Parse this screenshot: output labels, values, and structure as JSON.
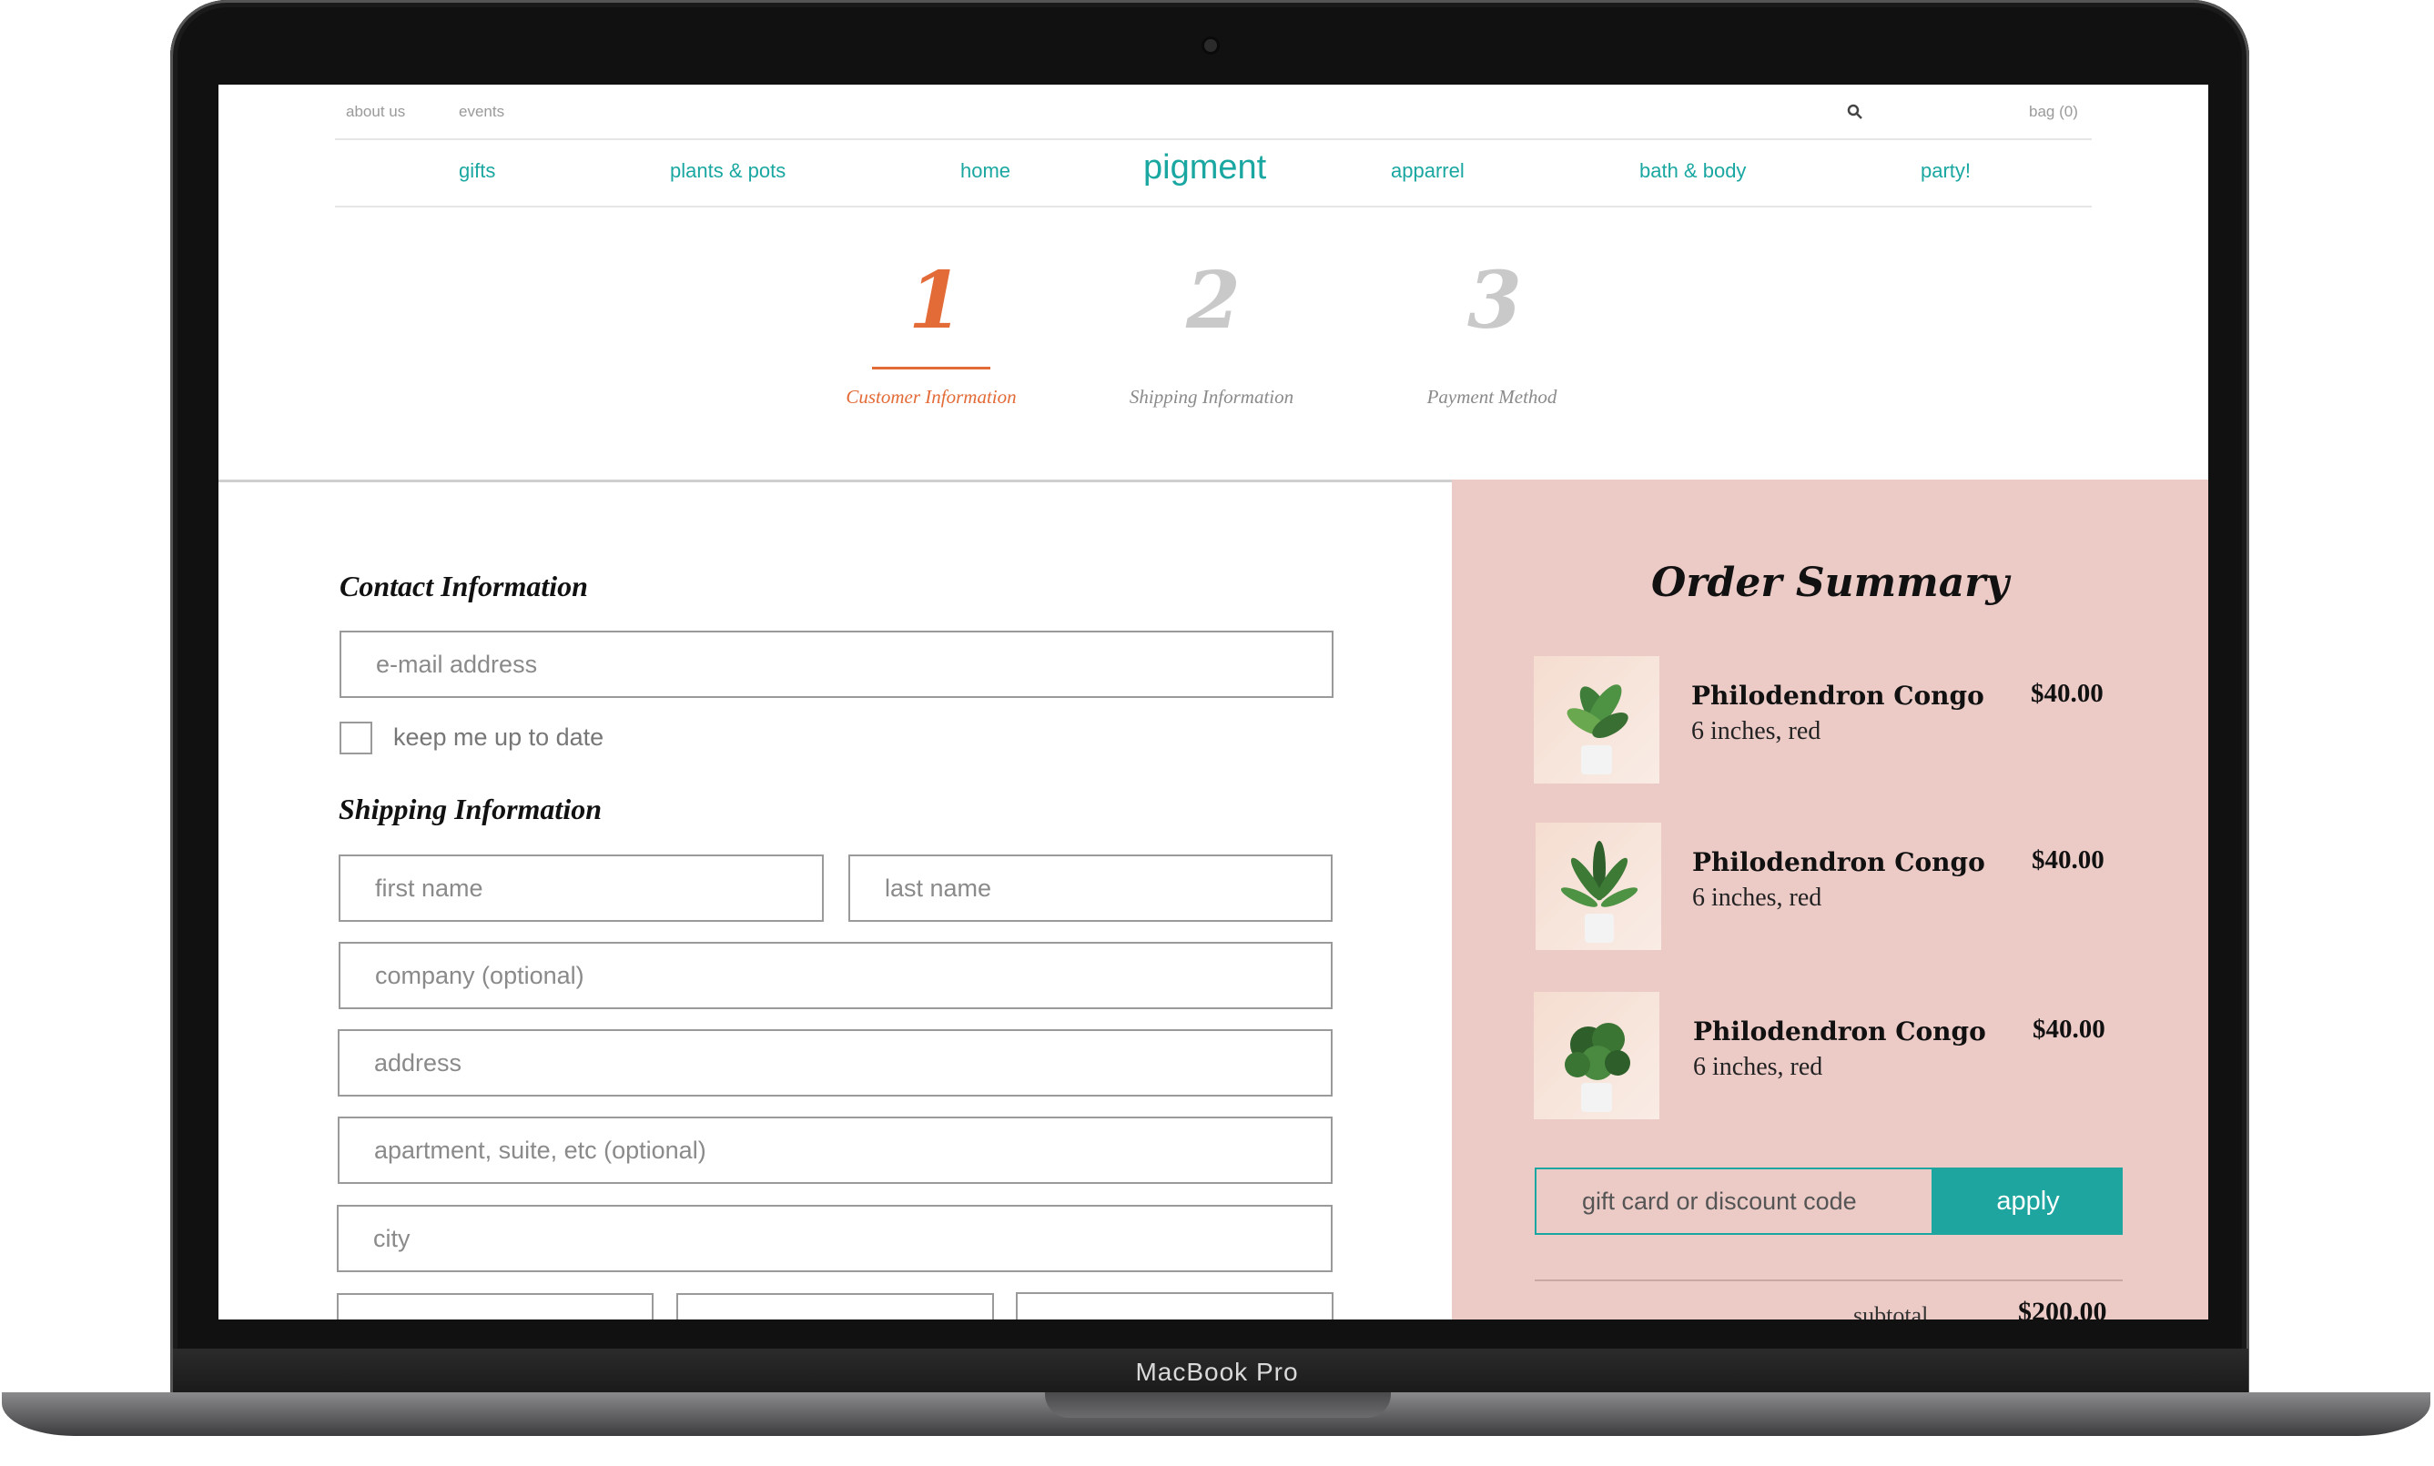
{
  "device": {
    "label": "MacBook Pro"
  },
  "utility_nav": {
    "about": "about us",
    "events": "events",
    "bag": "bag (0)"
  },
  "main_nav": {
    "logo": "pigment",
    "links": [
      "gifts",
      "plants & pots",
      "home",
      "apparrel",
      "bath & body",
      "party!"
    ]
  },
  "steps": [
    {
      "number": "1",
      "label": "Customer Information",
      "active": true
    },
    {
      "number": "2",
      "label": "Shipping Information",
      "active": false
    },
    {
      "number": "3",
      "label": "Payment Method",
      "active": false
    }
  ],
  "contact": {
    "title": "Contact Information",
    "email_placeholder": "e-mail address",
    "newsletter_label": "keep me up to date"
  },
  "shipping": {
    "title": "Shipping Information",
    "first_name_placeholder": "first name",
    "last_name_placeholder": "last name",
    "company_placeholder": "company (optional)",
    "address_placeholder": "address",
    "apartment_placeholder": "apartment, suite, etc (optional)",
    "city_placeholder": "city"
  },
  "summary": {
    "title": "Order Summary",
    "items": [
      {
        "name": "Philodendron Congo",
        "variant": "6 inches, red",
        "price": "$40.00"
      },
      {
        "name": "Philodendron Congo",
        "variant": "6 inches, red",
        "price": "$40.00"
      },
      {
        "name": "Philodendron Congo",
        "variant": "6 inches, red",
        "price": "$40.00"
      }
    ],
    "code_placeholder": "gift card or discount code",
    "apply_label": "apply",
    "subtotal_label": "subtotal",
    "subtotal_value": "$200.00"
  },
  "colors": {
    "accent": "#1aa7a1",
    "active_step": "#e36b38",
    "summary_bg": "#eccbc7"
  }
}
